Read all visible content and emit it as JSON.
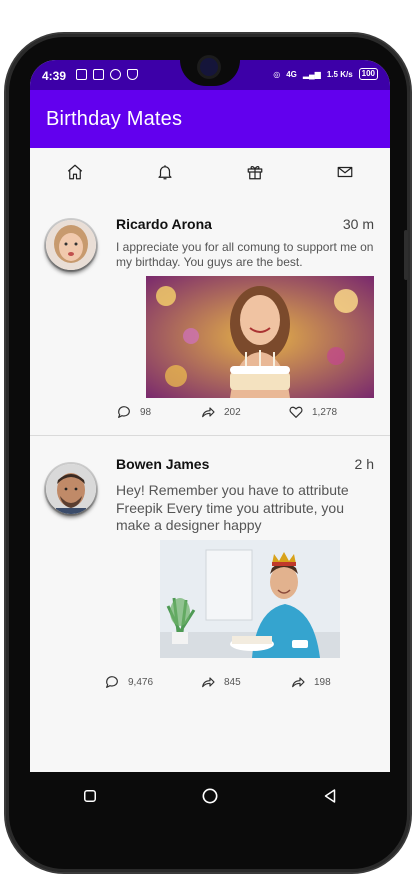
{
  "status": {
    "time": "4:39",
    "net": "4G",
    "speed": "1.5 K/s",
    "battery": "100"
  },
  "app": {
    "title": "Birthday Mates"
  },
  "tabs": [
    "home-icon",
    "bell-icon",
    "gift-icon",
    "mail-icon"
  ],
  "posts": [
    {
      "name": "Ricardo Arona",
      "time": "30 m",
      "text": "I appreciate you for all comung to support me on my birthday.  You guys are the best.",
      "comments": "98",
      "shares": "202",
      "likes": "1,278"
    },
    {
      "name": "Bowen James",
      "time": "2 h",
      "text": " Hey! Remember you have to attribute Freepik Every time you attribute, you make a designer happy",
      "comments": "9,476",
      "shares": "845",
      "shares2": "198"
    }
  ],
  "colors": {
    "statusbar": "#3d00a8",
    "appbar": "#6200ee",
    "background": "#f7f7f7"
  }
}
